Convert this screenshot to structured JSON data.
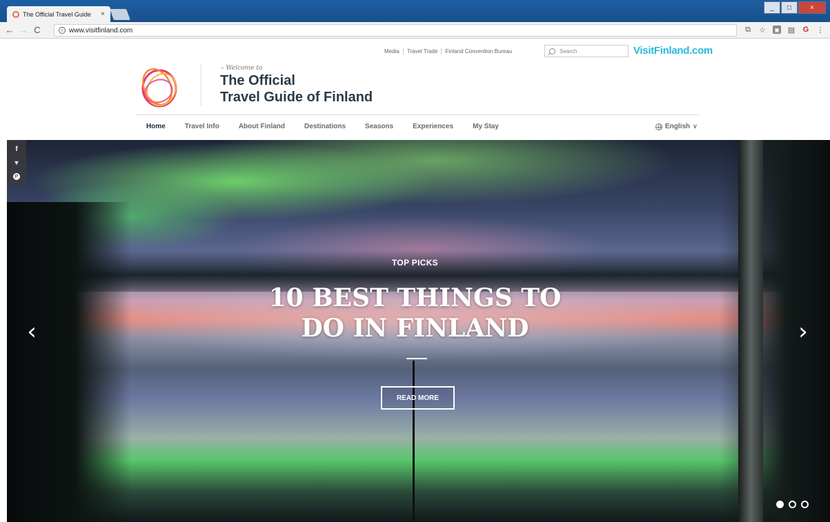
{
  "browser": {
    "tab_title": "The Official Travel Guide",
    "tab_close": "×",
    "url": "www.visitfinland.com",
    "window_controls": [
      "_",
      "□",
      "×"
    ]
  },
  "header": {
    "top_links": [
      "Media",
      "Travel Trade",
      "Finland Convention Bureau"
    ],
    "search_placeholder": "Search",
    "brand_link": "VisitFinland.com",
    "welcome": "– Welcome to",
    "title_line1": "The Official",
    "title_line2": "Travel Guide of Finland",
    "logo_colors": [
      "#f48a3c",
      "#e8356f",
      "#f7b23b"
    ]
  },
  "nav": {
    "items": [
      "Home",
      "Travel Info",
      "About Finland",
      "Destinations",
      "Seasons",
      "Experiences",
      "My Stay"
    ],
    "active": "Home",
    "language": "English"
  },
  "social": {
    "facebook": "f",
    "twitter": "🐦",
    "pinterest": "P"
  },
  "hero": {
    "kicker": "TOP PICKS",
    "headline_line1": "10 BEST THINGS TO",
    "headline_line2": "DO IN FINLAND",
    "cta": "READ MORE",
    "slides": 3,
    "active_slide": 1
  }
}
